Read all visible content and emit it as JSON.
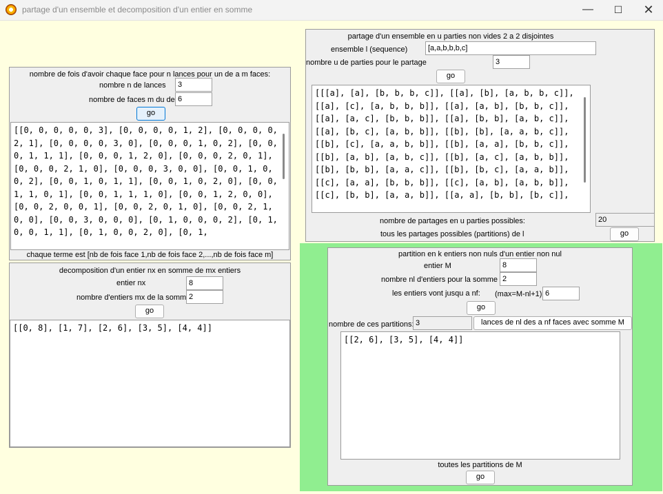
{
  "window": {
    "title": "partage d'un ensemble et decomposition d'un entier en somme",
    "minimize": "—",
    "maximize": "☐",
    "close": "✕"
  },
  "dice": {
    "heading": "nombre de fois d'avoir chaque face pour n lances pour un de a m faces:",
    "n_label": "nombre n de lances",
    "n_value": "3",
    "m_label": "nombre de faces m du de",
    "m_value": "6",
    "go": "go",
    "result": "[[0, 0, 0, 0, 0, 3], [0, 0, 0, 0, 1, 2], [0, 0, 0, 0, 2, 1], [0, 0, 0, 0, 3, 0], [0, 0, 0, 1, 0, 2], [0, 0, 0, 1, 1, 1], [0, 0, 0, 1, 2, 0], [0, 0, 0, 2, 0, 1], [0, 0, 0, 2, 1, 0], [0, 0, 0, 3, 0, 0], [0, 0, 1, 0, 0, 2], [0, 0, 1, 0, 1, 1], [0, 0, 1, 0, 2, 0], [0, 0, 1, 1, 0, 1], [0, 0, 1, 1, 1, 0], [0, 0, 1, 2, 0, 0], [0, 0, 2, 0, 0, 1], [0, 0, 2, 0, 1, 0], [0, 0, 2, 1, 0, 0], [0, 0, 3, 0, 0, 0], [0, 1, 0, 0, 0, 2], [0, 1, 0, 0, 1, 1], [0, 1, 0, 0, 2, 0], [0, 1,",
    "footer": "chaque terme est [nb de fois face 1,nb de fois face 2,...,nb de fois face m]"
  },
  "decomp": {
    "heading": "decomposition d'un entier nx en somme de mx entiers",
    "nx_label": "entier nx",
    "nx_value": "8",
    "mx_label": "nombre d'entiers mx de la somme",
    "mx_value": "2",
    "go": "go",
    "result": "[[0, 8], [1, 7], [2, 6], [3, 5], [4, 4]]"
  },
  "partage": {
    "heading": "partage d'un ensemble en u parties non vides 2 a 2 disjointes",
    "set_label": "ensemble l (sequence)",
    "set_value": "[a,a,b,b,b,c]",
    "u_label": "nombre u de parties pour le partage",
    "u_value": "3",
    "go": "go",
    "result": "[[[a], [a], [b, b, b, c]], [[a], [b], [a, b, b, c]], [[a], [c], [a, b, b, b]], [[a], [a, b], [b, b, c]], [[a], [a, c], [b, b, b]], [[a], [b, b], [a, b, c]], [[a], [b, c], [a, b, b]], [[b], [b], [a, a, b, c]], [[b], [c], [a, a, b, b]], [[b], [a, a], [b, b, c]], [[b], [a, b], [a, b, c]], [[b], [a, c], [a, b, b]], [[b], [b, b], [a, a, c]], [[b], [b, c], [a, a, b]], [[c], [a, a], [b, b, b]], [[c], [a, b], [a, b, b]], [[c], [b, b], [a, a, b]], [[a, a], [b, b], [b, c]],",
    "count_label": "nombre de partages en u parties possibles:",
    "count_value": "20",
    "all_label": "tous les partages possibles (partitions) de l",
    "all_go": "go"
  },
  "partition": {
    "heading": "partition en k entiers non nuls d'un entier non nul",
    "M_label": "entier M",
    "M_value": "8",
    "nl_label": "nombre nl d'entiers pour la somme",
    "nl_value": "2",
    "nf_label": "les entiers vont jusqu a nf:",
    "nf_hint": "(max=M-nl+1)",
    "nf_value": "6",
    "go": "go",
    "count_label": "nombre de ces partitions:",
    "count_value": "3",
    "dice_button": "lances de nl des a nf faces avec somme M",
    "result": "[[2, 6], [3, 5], [4, 4]]",
    "all_label": "toutes les partitions de M",
    "all_go": "go"
  }
}
